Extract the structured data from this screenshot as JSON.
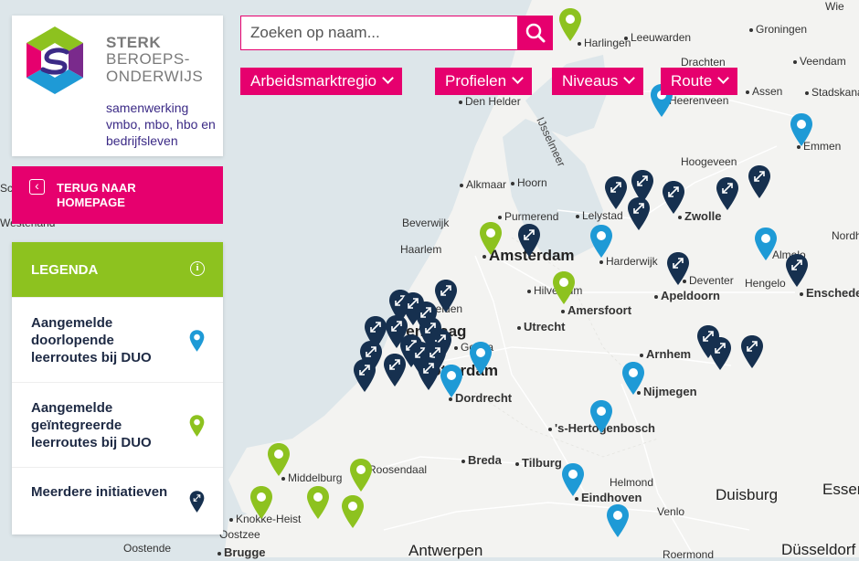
{
  "logo": {
    "title_line1": "STERK",
    "title_line2": "BEROEPS-ONDERWIJS",
    "tagline": "samenwerking vmbo, mbo, hbo en bedrijfsleven"
  },
  "back_button": {
    "label": "TERUG NAAR HOMEPAGE"
  },
  "legend": {
    "title": "LEGENDA",
    "items": [
      {
        "label": "Aangemelde doorlopende leerroutes bij DUO",
        "pin_color": "#1e9ad6"
      },
      {
        "label": "Aangemelde geïntegreerde leerroutes bij DUO",
        "pin_color": "#8dc21f"
      },
      {
        "label": "Meerdere initiatieven",
        "pin_color": "#16304f"
      }
    ]
  },
  "search": {
    "placeholder": "Zoeken op naam..."
  },
  "filters": [
    {
      "label": "Arbeidsmarktregio"
    },
    {
      "label": "Profielen"
    },
    {
      "label": "Niveaus"
    },
    {
      "label": "Route"
    }
  ],
  "colors": {
    "brand_pink": "#e6006e",
    "brand_green": "#8dc21f",
    "pin_blue": "#1e9ad6",
    "pin_navy": "#16304f",
    "land": "#f4f4f2",
    "water": "#dde6ea"
  },
  "map": {
    "places": [
      "Groningen",
      "Harlingen",
      "Leeuwarden",
      "Veendam",
      "Drachten",
      "Stadskanaal",
      "Den Helder",
      "Heerenveen",
      "Assen",
      "Emmen",
      "Hoogeveen",
      "Alkmaar",
      "Hoorn",
      "Lelystad",
      "Zwolle",
      "Beverwijk",
      "Purmerend",
      "Haarlem",
      "Amsterdam",
      "Harderwijk",
      "Nordhorn",
      "Almelo",
      "Hengelo",
      "Enschede",
      "Deventer",
      "Apeldoorn",
      "Hilversum",
      "Amersfoort",
      "Leiden",
      "Utrecht",
      "Den Haag",
      "Gouda",
      "Rotterdam",
      "Arnhem",
      "Nijmegen",
      "Dordrecht",
      "'s-Hertogenbosch",
      "Breda",
      "Tilburg",
      "Middelburg",
      "Roosendaal",
      "Helmond",
      "Eindhoven",
      "Duisburg",
      "Essen",
      "Venlo",
      "Knokke-Heist",
      "Oostende",
      "Brugge",
      "Antwerpen",
      "Roermond",
      "Düsseldorf",
      "Schagen",
      "Westerland",
      "Wie",
      "Oostzee",
      "IJsselmeer"
    ]
  }
}
